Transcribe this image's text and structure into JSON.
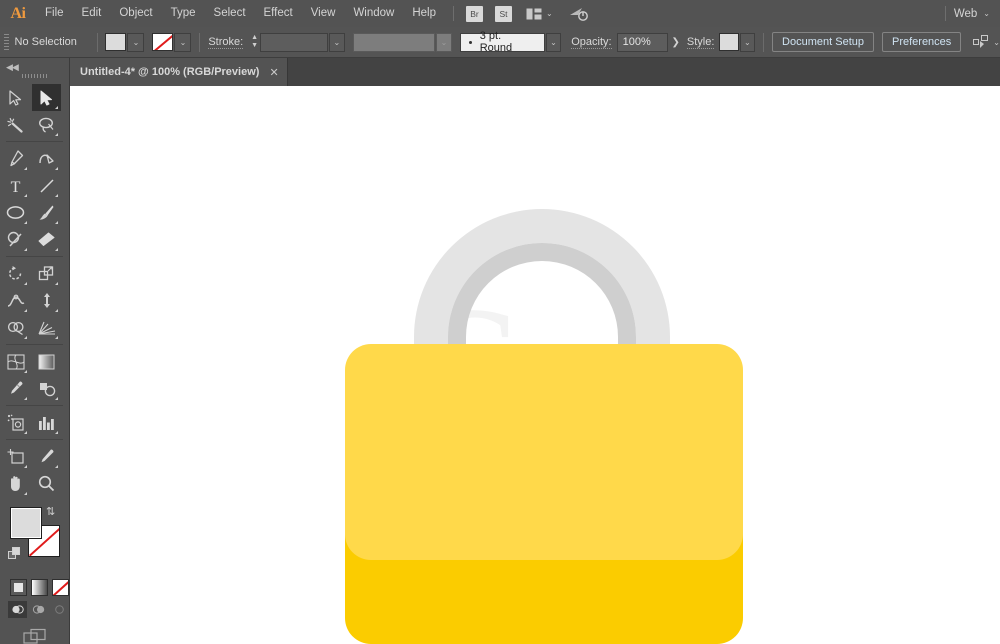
{
  "app": {
    "name": "Adobe Illustrator",
    "logo_text": "Ai"
  },
  "menubar": {
    "items": [
      {
        "label": "File"
      },
      {
        "label": "Edit"
      },
      {
        "label": "Object"
      },
      {
        "label": "Type"
      },
      {
        "label": "Select"
      },
      {
        "label": "Effect"
      },
      {
        "label": "View"
      },
      {
        "label": "Window"
      },
      {
        "label": "Help"
      }
    ],
    "bridge_chip": "Br",
    "stock_chip": "St",
    "arrange_icon": "arrange-documents-icon",
    "sync_icon": "sync-settings-icon",
    "workspace": "Web",
    "workspace_chevron": "⌄"
  },
  "controlbar": {
    "selection_status": "No Selection",
    "fill_swatch": "#dcdcdc",
    "stroke_swatch": "none",
    "stroke_label": "Stroke:",
    "stroke_weight": "",
    "variable_width_profile": "",
    "brush_definition": "3 pt. Round",
    "opacity_label": "Opacity:",
    "opacity_value": "100%",
    "opacity_more": "❯",
    "style_label": "Style:",
    "style_swatch": "#e2e2e2",
    "document_setup_label": "Document Setup",
    "preferences_label": "Preferences",
    "align_icon": "align-to-selection-icon"
  },
  "tabbar": {
    "document_title": "Untitled-4* @ 100% (RGB/Preview)",
    "close_label": "✕"
  },
  "toolpanel": {
    "collapse_icon": "collapse-panel-icon",
    "collapse_glyph": "◀◀",
    "grip": "panel-drag-grip",
    "tools": [
      {
        "name": "selection-tool",
        "selected": false
      },
      {
        "name": "direct-selection-tool",
        "selected": true
      },
      {
        "name": "magic-wand-tool",
        "selected": false
      },
      {
        "name": "lasso-tool",
        "selected": false
      },
      {
        "name": "pen-tool",
        "selected": false
      },
      {
        "name": "curvature-tool",
        "selected": false
      },
      {
        "name": "type-tool",
        "selected": false
      },
      {
        "name": "line-segment-tool",
        "selected": false
      },
      {
        "name": "ellipse-tool",
        "selected": false
      },
      {
        "name": "paintbrush-tool",
        "selected": false
      },
      {
        "name": "shaper-tool",
        "selected": false
      },
      {
        "name": "eraser-tool",
        "selected": false
      },
      {
        "name": "rotate-tool",
        "selected": false
      },
      {
        "name": "scale-tool",
        "selected": false
      },
      {
        "name": "width-tool",
        "selected": false
      },
      {
        "name": "free-transform-tool",
        "selected": false
      },
      {
        "name": "shape-builder-tool",
        "selected": false
      },
      {
        "name": "perspective-grid-tool",
        "selected": false
      },
      {
        "name": "mesh-tool",
        "selected": false
      },
      {
        "name": "gradient-tool",
        "selected": false
      },
      {
        "name": "eyedropper-tool",
        "selected": false
      },
      {
        "name": "blend-tool",
        "selected": false
      },
      {
        "name": "symbol-sprayer-tool",
        "selected": false
      },
      {
        "name": "column-graph-tool",
        "selected": false
      },
      {
        "name": "artboard-tool",
        "selected": false
      },
      {
        "name": "slice-tool",
        "selected": false
      },
      {
        "name": "hand-tool",
        "selected": false
      },
      {
        "name": "zoom-tool",
        "selected": false
      }
    ],
    "color_controls": {
      "fill_color": "#dcdcdc",
      "stroke_color": "none",
      "swap_icon": "swap-fill-stroke-icon",
      "default_icon": "default-fill-stroke-icon",
      "modes": [
        "color-mode",
        "gradient-mode",
        "none-mode"
      ],
      "draw_modes": [
        "draw-normal",
        "draw-behind",
        "draw-inside"
      ],
      "screen_mode_icon": "change-screen-mode-icon"
    }
  },
  "canvas": {
    "background": "#ffffff",
    "watermark_letter": "G",
    "watermark_text": "",
    "artwork": {
      "name": "padlock-illustration",
      "body_light": "#ffd94a",
      "body_dark": "#fbcc00",
      "shackle_outer": "#e4e4e4",
      "shackle_inner": "#cdcdcd",
      "shackle_edge": "#d6d6d6"
    }
  }
}
